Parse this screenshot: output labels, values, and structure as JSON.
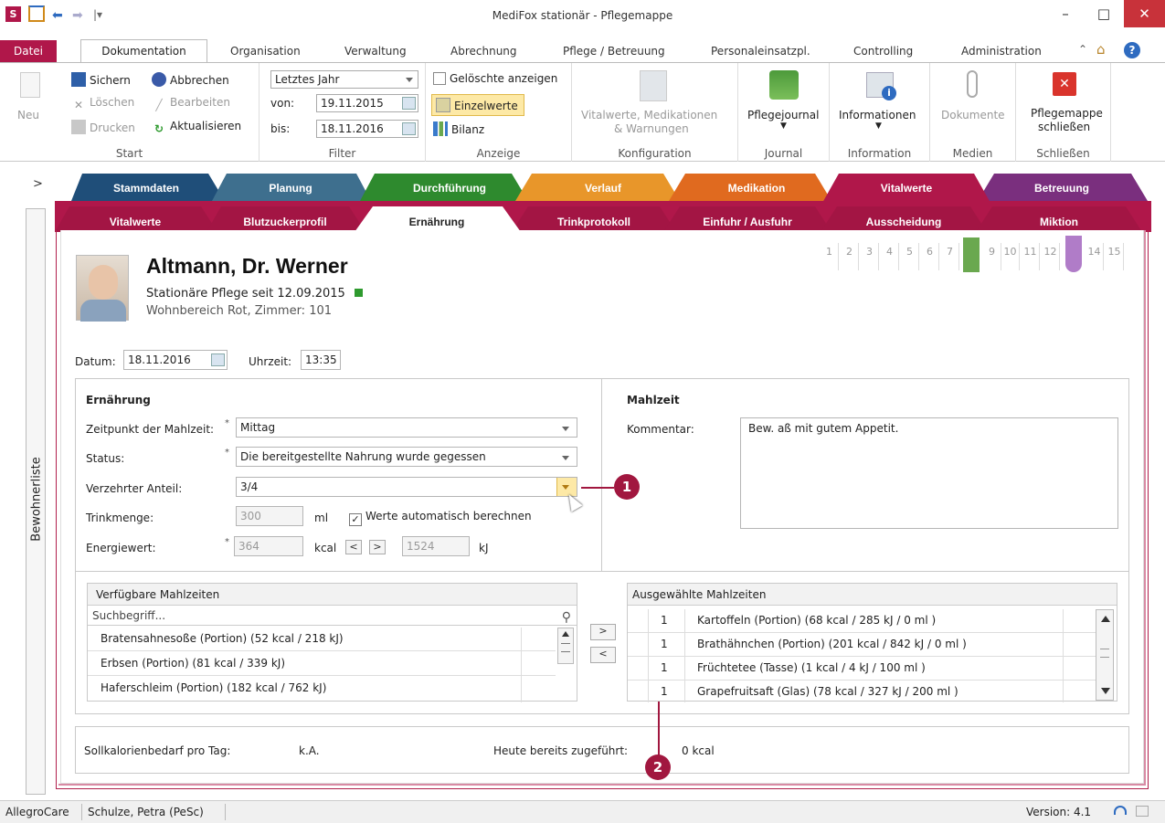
{
  "window": {
    "title": "MediFox stationär - Pflegemappe",
    "app_icon": "S",
    "minimize": "–",
    "maximize": "□",
    "close": "✕"
  },
  "menu": {
    "datei": "Datei",
    "tabs": [
      "Dokumentation",
      "Organisation",
      "Verwaltung",
      "Abrechnung",
      "Pflege / Betreuung",
      "Personaleinsatzpl.",
      "Controlling",
      "Administration"
    ]
  },
  "ribbon": {
    "start": {
      "neu": "Neu",
      "sichern": "Sichern",
      "abbrechen": "Abbrechen",
      "loeschen": "Löschen",
      "bearbeiten": "Bearbeiten",
      "drucken": "Drucken",
      "aktualisieren": "Aktualisieren",
      "label": "Start"
    },
    "filter": {
      "period": "Letztes Jahr",
      "von_label": "von:",
      "von": "19.11.2015",
      "bis_label": "bis:",
      "bis": "18.11.2016",
      "label": "Filter"
    },
    "anzeige": {
      "geloeschte": "Gelöschte anzeigen",
      "einzelwerte": "Einzelwerte",
      "bilanz": "Bilanz",
      "label": "Anzeige"
    },
    "konfiguration": {
      "vital": "Vitalwerte, Medikationen",
      "warnungen": "& Warnungen",
      "label": "Konfiguration"
    },
    "journal": {
      "pflegejournal": "Pflegejournal",
      "label": "Journal"
    },
    "information": {
      "informationen": "Informationen",
      "label": "Information"
    },
    "medien": {
      "dokumente": "Dokumente",
      "label": "Medien"
    },
    "schliessen": {
      "line1": "Pflegemappe",
      "line2": "schließen",
      "label": "Schließen"
    }
  },
  "main_tabs": [
    "Stammdaten",
    "Planung",
    "Durchführung",
    "Verlauf",
    "Medikation",
    "Vitalwerte",
    "Betreuung"
  ],
  "sub_tabs": [
    "Vitalwerte",
    "Blutzuckerprofil",
    "Ernährung",
    "Trinkprotokoll",
    "Einfuhr / Ausfuhr",
    "Ausscheidung",
    "Miktion"
  ],
  "sidebar": {
    "label": "Bewohnerliste",
    "expand": ">"
  },
  "page_numbers": [
    "1",
    "2",
    "3",
    "4",
    "5",
    "6",
    "7",
    "8",
    "9",
    "10",
    "11",
    "12",
    "13",
    "14",
    "15"
  ],
  "patient": {
    "name": "Altmann, Dr. Werner",
    "care": "Stationäre Pflege seit 12.09.2015",
    "room": "Wohnbereich Rot, Zimmer: 101"
  },
  "date_row": {
    "datum_label": "Datum:",
    "datum": "18.11.2016",
    "uhrzeit_label": "Uhrzeit:",
    "uhrzeit": "13:35"
  },
  "ernaehrung": {
    "heading": "Ernährung",
    "zeitpunkt_label": "Zeitpunkt der Mahlzeit:",
    "zeitpunkt": "Mittag",
    "status_label": "Status:",
    "status": "Die bereitgestellte Nahrung wurde gegessen",
    "anteil_label": "Verzehrter Anteil:",
    "anteil": "3/4",
    "trink_label": "Trinkmenge:",
    "trink": "300",
    "trink_unit": "ml",
    "auto_label": "Werte automatisch berechnen",
    "energie_label": "Energiewert:",
    "energie_kcal": "364",
    "kcal_unit": "kcal",
    "btn_left": "<",
    "btn_right": ">",
    "energie_kj": "1524",
    "kj_unit": "kJ"
  },
  "mahlzeit": {
    "heading": "Mahlzeit",
    "kommentar_label": "Kommentar:",
    "kommentar": "Bew. aß mit gutem Appetit."
  },
  "verfuegbar": {
    "heading": "Verfügbare Mahlzeiten",
    "search_placeholder": "Suchbegriff...",
    "items": [
      "Bratensahnesoße (Portion) (52 kcal / 218 kJ)",
      "Erbsen (Portion) (81 kcal / 339 kJ)",
      "Haferschleim (Portion) (182 kcal / 762 kJ)"
    ]
  },
  "move": {
    "add": ">",
    "remove": "<"
  },
  "ausgewaehlt": {
    "heading": "Ausgewählte Mahlzeiten",
    "rows": [
      {
        "qty": "1",
        "name": "Kartoffeln (Portion) (68 kcal / 285 kJ / 0 ml )"
      },
      {
        "qty": "1",
        "name": "Brathähnchen (Portion) (201 kcal / 842 kJ / 0 ml )"
      },
      {
        "qty": "1",
        "name": "Früchtetee (Tasse) (1 kcal / 4 kJ / 100 ml )"
      },
      {
        "qty": "1",
        "name": "Grapefruitsaft (Glas) (78 kcal / 327 kJ / 200 ml )"
      }
    ]
  },
  "summary": {
    "soll_label": "Sollkalorienbedarf pro Tag:",
    "soll": "k.A.",
    "heute_label": "Heute bereits zugeführt:",
    "heute": "0 kcal"
  },
  "callouts": [
    "1",
    "2"
  ],
  "statusbar": {
    "org": "AllegroCare",
    "user": "Schulze, Petra (PeSc)",
    "version": "Version: 4.1"
  },
  "colors": {
    "accent": "#b0174a",
    "stammdaten": "#1f4e79",
    "planung": "#3e6f8e",
    "durchfuehrung": "#2e8a2e",
    "verlauf": "#e8962a",
    "medikation": "#e06a1f",
    "vitalwerte": "#b0174a",
    "betreuung": "#7a2f7e"
  }
}
